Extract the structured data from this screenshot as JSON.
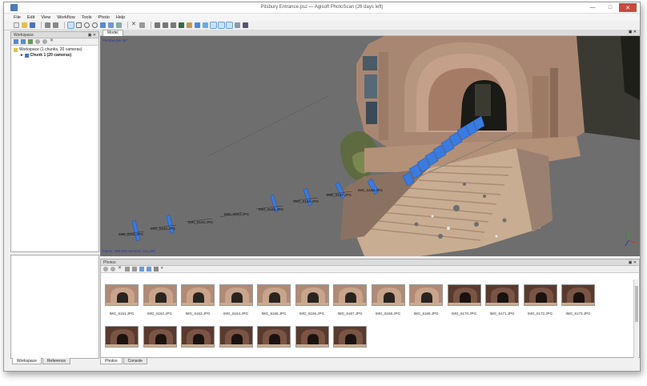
{
  "window": {
    "title": "Pitsbury Entrance.psz — Agisoft PhotoScan (26 days left)"
  },
  "menu": [
    "File",
    "Edit",
    "View",
    "Workflow",
    "Tools",
    "Photo",
    "Help"
  ],
  "workspace": {
    "header": "Workspace",
    "root": "Workspace (1 chunks, 20 cameras)",
    "chunk": "Chunk 1 (20 cameras)"
  },
  "model": {
    "tab": "Model",
    "perspective": "Perspective 30°",
    "stats": "Faces: 359,562 vertices: 111,208",
    "camera_labels": [
      "IMG_6161.JPG",
      "IMG_6162.JPG",
      "IMG_6163.JPG",
      "IMG_6164.JPG",
      "IMG_6165.JPG",
      "IMG_6166.JPG",
      "IMG_6167.JPG",
      "IMG_6168.JPG"
    ]
  },
  "photos": {
    "header": "Photos",
    "row1": [
      "IMG_6161.JPG",
      "IMG_6162.JPG",
      "IMG_6163.JPG",
      "IMG_6164.JPG",
      "IMG_6165.JPG",
      "IMG_6166.JPG",
      "IMG_6167.JPG",
      "IMG_6168.JPG",
      "IMG_6169.JPG",
      "IMG_6170.JPG",
      "IMG_6171.JPG",
      "IMG_6172.JPG",
      "IMG_6173.JPG"
    ],
    "row2_count": 7
  },
  "tabs_left": [
    "Workspace",
    "Reference"
  ],
  "tabs_bottom": [
    "Photos",
    "Console"
  ],
  "colors": {
    "camera_blue": "#3a7be0",
    "viewport_bg": "#6e6e6e",
    "stone": "#b08a74"
  }
}
